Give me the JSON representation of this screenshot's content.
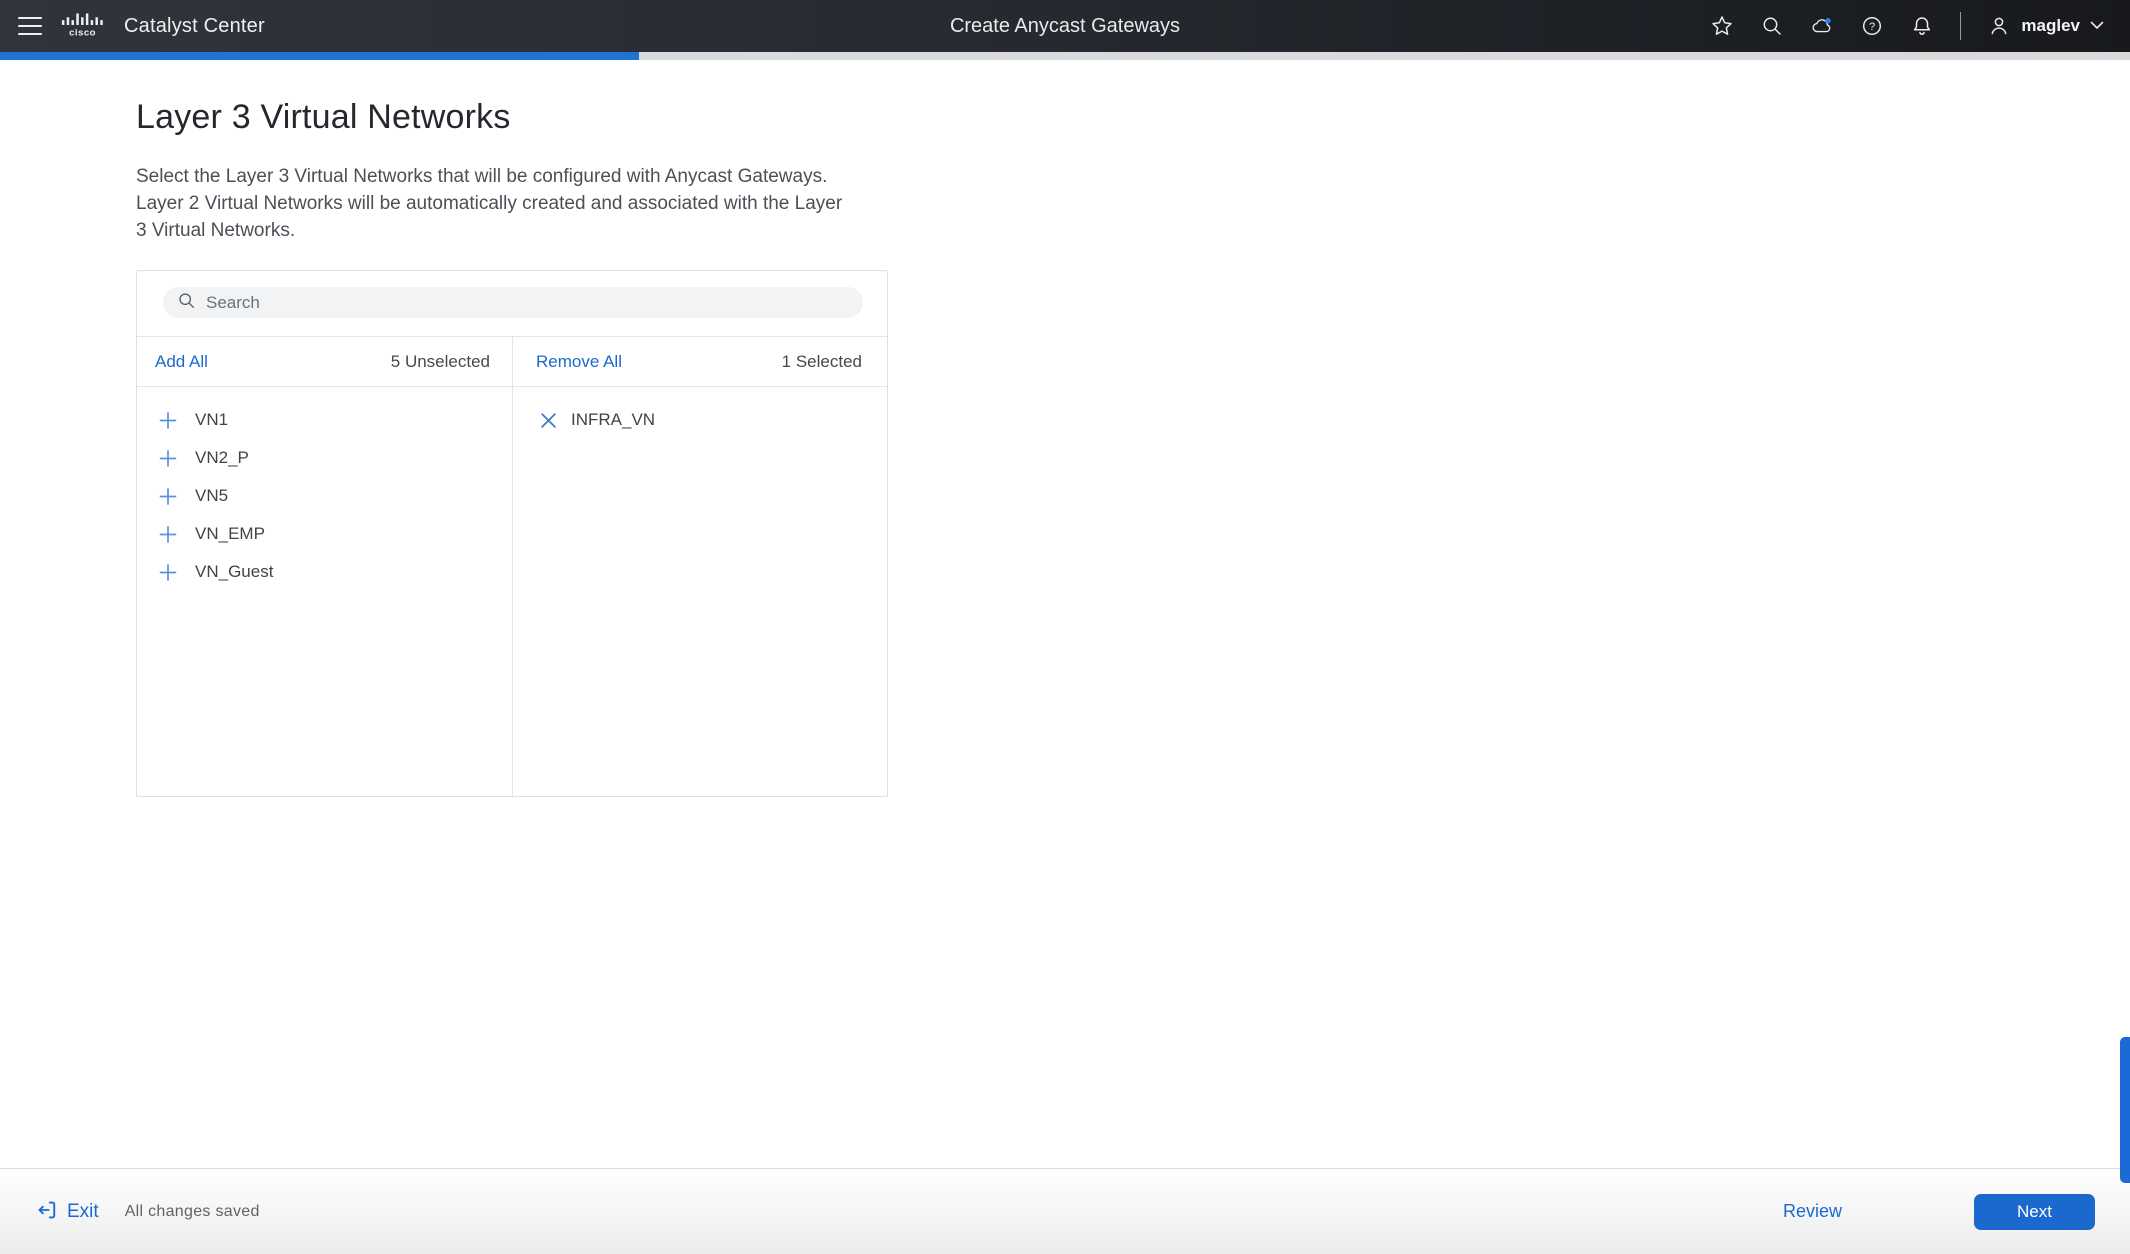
{
  "header": {
    "brand": "Catalyst Center",
    "title": "Create Anycast Gateways",
    "user": "maglev",
    "icons": [
      "menu",
      "cisco-logo",
      "favorites-star",
      "search",
      "cloud-status",
      "help",
      "notifications-bell",
      "user-account",
      "chevron-down"
    ]
  },
  "progress": {
    "percent": 30
  },
  "page": {
    "title": "Layer 3 Virtual Networks",
    "description_lines": [
      "Select the Layer 3 Virtual Networks that will be configured with Anycast Gateways.",
      "Layer 2 Virtual Networks will be automatically created and associated with the Layer",
      "3 Virtual Networks."
    ]
  },
  "transfer": {
    "search_placeholder": "Search",
    "left": {
      "action_label": "Add All",
      "count_label": "5 Unselected",
      "items": [
        "VN1",
        "VN2_P",
        "VN5",
        "VN_EMP",
        "VN_Guest"
      ]
    },
    "right": {
      "action_label": "Remove All",
      "count_label": "1 Selected",
      "items": [
        "INFRA_VN"
      ]
    }
  },
  "footer": {
    "exit_label": "Exit",
    "status_text": "All changes saved",
    "review_label": "Review",
    "next_label": "Next"
  },
  "colors": {
    "accent_blue": "#1b69cf",
    "progress_fill": "#2273cf",
    "header_bg": "#262b31",
    "cloud_badge_blue": "#2b80e0",
    "plus_icon_blue": "#5b92d8",
    "remove_icon_blue": "#3c76ca"
  }
}
